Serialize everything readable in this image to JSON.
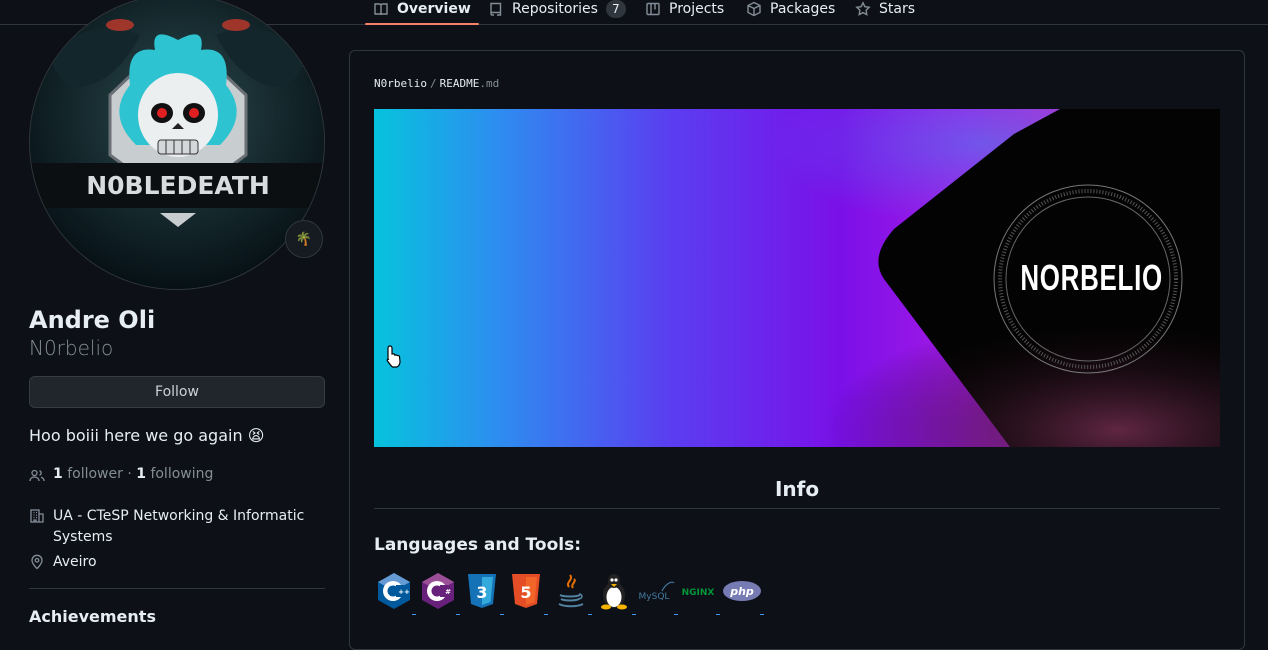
{
  "tabs": [
    {
      "label": "Overview",
      "icon": "book-icon",
      "active": true
    },
    {
      "label": "Repositories",
      "icon": "repo-icon",
      "count": "7"
    },
    {
      "label": "Projects",
      "icon": "project-icon"
    },
    {
      "label": "Packages",
      "icon": "package-icon"
    },
    {
      "label": "Stars",
      "icon": "star-icon"
    }
  ],
  "profile": {
    "avatar_text": "N0BLEDEATH",
    "status_emoji": "🌴",
    "fullname": "Andre Oli",
    "username": "N0rbelio",
    "follow_label": "Follow",
    "bio": "Hoo boiii here we go again 😫",
    "followers_count": "1",
    "followers_label": "follower",
    "following_count": "1",
    "following_label": "following",
    "organization": "UA - CTeSP Networking & Informatic Systems",
    "location": "Aveiro",
    "achievements_label": "Achievements"
  },
  "readme": {
    "owner": "N0rbelio",
    "sep": "/",
    "filename": "README",
    "ext": ".md",
    "banner_text": "NORBELIO",
    "info_heading": "Info",
    "languages_heading": "Languages and Tools:",
    "tools": [
      "cplusplus-icon",
      "csharp-icon",
      "css3-icon",
      "html5-icon",
      "java-icon",
      "linux-icon",
      "mysql-icon",
      "nginx-icon",
      "php-icon"
    ],
    "tool_text": {
      "mysql": "MySQL",
      "nginx": "NGINX",
      "php": "php",
      "css": "3",
      "html": "5",
      "csharp": "C#",
      "cpp": "C++"
    }
  },
  "colors": {
    "background": "#0d1117",
    "border": "#30363d",
    "accent_tab": "#f78166",
    "muted": "#848d97",
    "link": "#4493f8"
  }
}
